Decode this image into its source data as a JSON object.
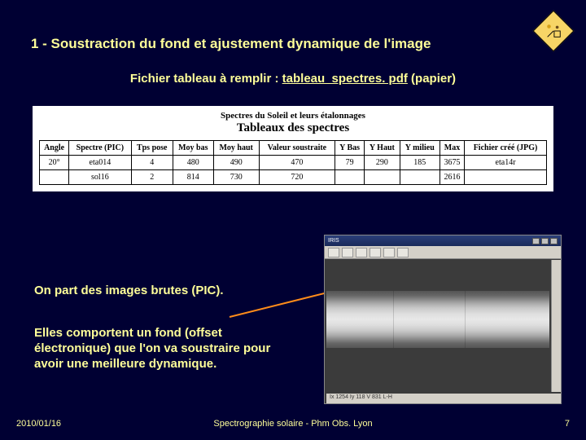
{
  "title": "1 - Soustraction du fond et ajustement dynamique de l'image",
  "subtitle_prefix": "Fichier tableau à remplir : ",
  "subtitle_link": "tableau_spectres. pdf",
  "subtitle_suffix": " (papier)",
  "table": {
    "heading_line1": "Spectres du Soleil et leurs étalonnages",
    "heading_line2": "Tableaux des spectres",
    "headers": [
      "Angle",
      "Spectre (PIC)",
      "Tps pose",
      "Moy bas",
      "Moy haut",
      "Valeur soustraite",
      "Y Bas",
      "Y Haut",
      "Y milieu",
      "Max",
      "Fichier créé (JPG)"
    ],
    "rows": [
      [
        "20°",
        "eta014",
        "4",
        "480",
        "490",
        "470",
        "79",
        "290",
        "185",
        "3675",
        "eta14r"
      ],
      [
        "",
        "sol16",
        "2",
        "814",
        "730",
        "720",
        "",
        "",
        "",
        "2616",
        ""
      ]
    ]
  },
  "body_text1": "On part des images brutes (PIC).",
  "body_text2": "Elles comportent un fond (offset électronique) que l'on va soustraire pour avoir une meilleure dynamique.",
  "window": {
    "title_text": "IRIS",
    "status": "Ix 1254 Iy 118  V 831  L-H"
  },
  "footer": {
    "date": "2010/01/16",
    "center": "Spectrographie solaire - Phm Obs. Lyon",
    "page": "7"
  }
}
